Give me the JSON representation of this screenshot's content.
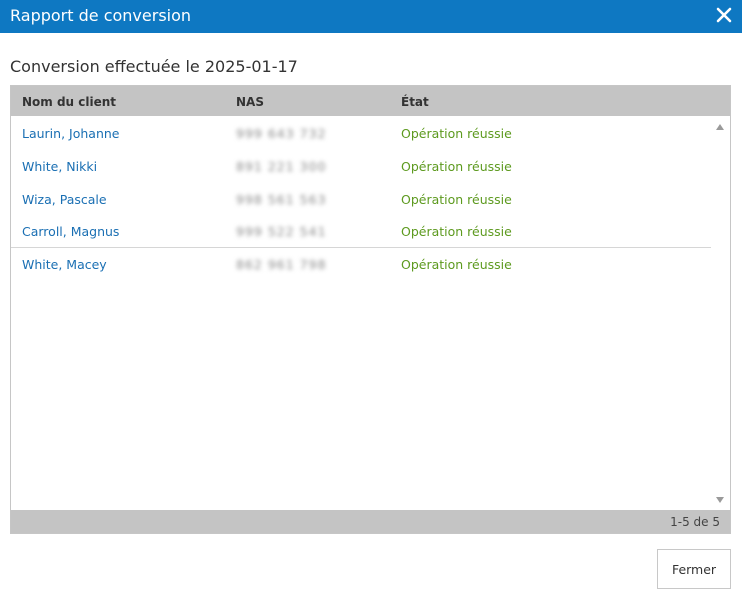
{
  "dialog": {
    "title": "Rapport de conversion",
    "close_icon": "close-icon",
    "subtitle": "Conversion effectuée le 2025-01-17",
    "close_button_label": "Fermer"
  },
  "table": {
    "columns": [
      "Nom du client",
      "NAS",
      "État"
    ],
    "rows": [
      {
        "name": "Laurin, Johanne",
        "nas": "999 643 732",
        "state": "Opération réussie"
      },
      {
        "name": "White, Nikki",
        "nas": "891 221 300",
        "state": "Opération réussie"
      },
      {
        "name": "Wiza, Pascale",
        "nas": "998 561 563",
        "state": "Opération réussie"
      },
      {
        "name": "Carroll, Magnus",
        "nas": "999 522 541",
        "state": "Opération réussie"
      },
      {
        "name": "White, Macey",
        "nas": "862 961 798",
        "state": "Opération réussie"
      }
    ],
    "pagination": "1-5 de 5"
  },
  "colors": {
    "titlebar": "#0e78c2",
    "link": "#1a6fb3",
    "success": "#5d9a1f",
    "header_bg": "#c4c4c4"
  }
}
